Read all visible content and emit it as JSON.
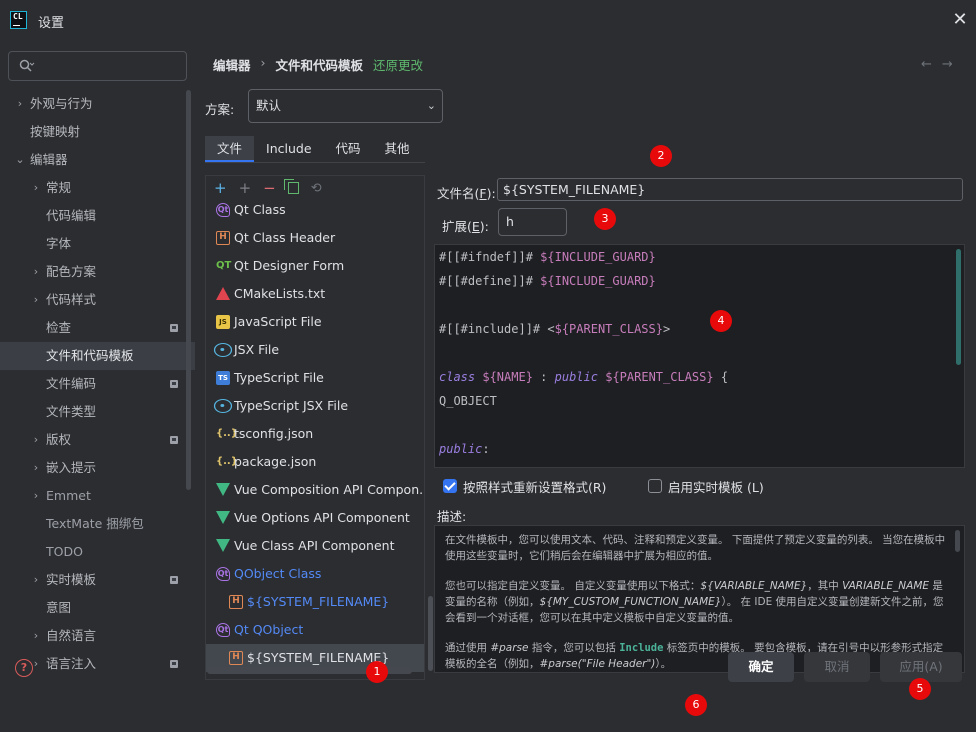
{
  "window": {
    "title": "设置",
    "logo_text": "CL"
  },
  "sidebar": {
    "search_placeholder": "",
    "items": [
      {
        "label": "外观与行为",
        "chevron": "›",
        "level": 0,
        "pinned": false
      },
      {
        "label": "按键映射",
        "chevron": "",
        "level": 0,
        "pinned": false
      },
      {
        "label": "编辑器",
        "chevron": "⌄",
        "level": 0,
        "pinned": false
      },
      {
        "label": "常规",
        "chevron": "›",
        "level": 1,
        "pinned": false
      },
      {
        "label": "代码编辑",
        "chevron": "",
        "level": 1,
        "pinned": false
      },
      {
        "label": "字体",
        "chevron": "",
        "level": 1,
        "pinned": false
      },
      {
        "label": "配色方案",
        "chevron": "›",
        "level": 1,
        "pinned": false
      },
      {
        "label": "代码样式",
        "chevron": "›",
        "level": 1,
        "pinned": false
      },
      {
        "label": "检查",
        "chevron": "",
        "level": 1,
        "pinned": true
      },
      {
        "label": "文件和代码模板",
        "chevron": "",
        "level": 1,
        "pinned": false,
        "selected": true
      },
      {
        "label": "文件编码",
        "chevron": "",
        "level": 1,
        "pinned": true
      },
      {
        "label": "文件类型",
        "chevron": "",
        "level": 1,
        "pinned": false
      },
      {
        "label": "版权",
        "chevron": "›",
        "level": 1,
        "pinned": true
      },
      {
        "label": "嵌入提示",
        "chevron": "›",
        "level": 1,
        "pinned": false
      },
      {
        "label": "Emmet",
        "chevron": "›",
        "level": 1,
        "pinned": false,
        "dim": true
      },
      {
        "label": "TextMate 捆绑包",
        "chevron": "",
        "level": 1,
        "pinned": false,
        "dim": true
      },
      {
        "label": "TODO",
        "chevron": "",
        "level": 1,
        "pinned": false,
        "dim": true
      },
      {
        "label": "实时模板",
        "chevron": "›",
        "level": 1,
        "pinned": true
      },
      {
        "label": "意图",
        "chevron": "",
        "level": 1,
        "pinned": false
      },
      {
        "label": "自然语言",
        "chevron": "›",
        "level": 1,
        "pinned": false
      },
      {
        "label": "语言注入",
        "chevron": "›",
        "level": 1,
        "pinned": true
      }
    ]
  },
  "breadcrumb": {
    "parent": "编辑器",
    "separator": "›",
    "current": "文件和代码模板",
    "revert_label": "还原更改"
  },
  "nav": {
    "back": "←",
    "forward": "→"
  },
  "scheme": {
    "label": "方案:",
    "value": "默认",
    "dropdown_icon": "⌄"
  },
  "tabs": [
    {
      "label": "文件",
      "active": true
    },
    {
      "label": "Include",
      "active": false
    },
    {
      "label": "代码",
      "active": false
    },
    {
      "label": "其他",
      "active": false
    }
  ],
  "toolbar": {
    "add": "+",
    "add_child": "+",
    "remove": "−",
    "reset": "⟲"
  },
  "templates": [
    {
      "label": "Qt Class",
      "icon": "qt-icon",
      "glyph": "Qt",
      "indent": 0,
      "link": false
    },
    {
      "label": "Qt Class Header",
      "icon": "header-icon",
      "glyph": "H",
      "indent": 0,
      "link": false
    },
    {
      "label": "Qt Designer Form",
      "icon": "qt-designer-icon",
      "glyph": "QT",
      "indent": 0,
      "link": false
    },
    {
      "label": "CMakeLists.txt",
      "icon": "cmake-icon",
      "glyph": "",
      "indent": 0,
      "link": false
    },
    {
      "label": "JavaScript File",
      "icon": "javascript-icon",
      "glyph": "JS",
      "indent": 0,
      "link": false
    },
    {
      "label": "JSX File",
      "icon": "react-icon",
      "glyph": "",
      "indent": 0,
      "link": false
    },
    {
      "label": "TypeScript File",
      "icon": "typescript-icon",
      "glyph": "TS",
      "indent": 0,
      "link": false
    },
    {
      "label": "TypeScript JSX File",
      "icon": "react-icon",
      "glyph": "",
      "indent": 0,
      "link": false
    },
    {
      "label": "tsconfig.json",
      "icon": "json-icon",
      "glyph": "{..}",
      "indent": 0,
      "link": false
    },
    {
      "label": "package.json",
      "icon": "json-icon",
      "glyph": "{..}",
      "indent": 0,
      "link": false
    },
    {
      "label": "Vue Composition API Compon...",
      "icon": "vue-icon",
      "glyph": "",
      "indent": 0,
      "link": false
    },
    {
      "label": "Vue Options API Component",
      "icon": "vue-icon",
      "glyph": "",
      "indent": 0,
      "link": false
    },
    {
      "label": "Vue Class API Component",
      "icon": "vue-icon",
      "glyph": "",
      "indent": 0,
      "link": false
    },
    {
      "label": "QObject Class",
      "icon": "qt-icon",
      "glyph": "Qt",
      "indent": 0,
      "link": true
    },
    {
      "label": "${SYSTEM_FILENAME}",
      "icon": "header-icon",
      "glyph": "H",
      "indent": 1,
      "link": true
    },
    {
      "label": "Qt QObject",
      "icon": "qt-icon",
      "glyph": "Qt",
      "indent": 0,
      "link": true
    },
    {
      "label": "${SYSTEM_FILENAME}",
      "icon": "header-icon",
      "glyph": "H",
      "indent": 1,
      "link": false,
      "selected": true
    }
  ],
  "form": {
    "filename_label": "文件名(",
    "filename_key": "F",
    "filename_label_end": "):",
    "filename_value": "${SYSTEM_FILENAME}",
    "ext_label": "扩展(",
    "ext_key": "E",
    "ext_label_end": "):",
    "ext_value": "h"
  },
  "code_lines": [
    [
      {
        "t": "#[[#ifndef]]# ",
        "c": "dir"
      },
      {
        "t": "${INCLUDE_GUARD}",
        "c": "var"
      }
    ],
    [
      {
        "t": "#[[#define]]# ",
        "c": "dir"
      },
      {
        "t": "${INCLUDE_GUARD}",
        "c": "var"
      }
    ],
    [],
    [
      {
        "t": "#[[#include]]# ",
        "c": "dir"
      },
      {
        "t": "<",
        "c": "dir"
      },
      {
        "t": "${PARENT_CLASS}",
        "c": "var"
      },
      {
        "t": ">",
        "c": "dir"
      }
    ],
    [],
    [
      {
        "t": "class",
        "c": "kw"
      },
      {
        "t": " ",
        "c": "dir"
      },
      {
        "t": "${NAME}",
        "c": "var"
      },
      {
        "t": " : ",
        "c": "dir"
      },
      {
        "t": "public",
        "c": "kw"
      },
      {
        "t": " ",
        "c": "dir"
      },
      {
        "t": "${PARENT_CLASS}",
        "c": "var"
      },
      {
        "t": " {",
        "c": "dir"
      }
    ],
    [
      {
        "t": "Q_OBJECT",
        "c": "dir"
      }
    ],
    [],
    [
      {
        "t": "public",
        "c": "kw"
      },
      {
        "t": ":",
        "c": "dir"
      }
    ]
  ],
  "options": {
    "reformat_label": "按照样式重新设置格式(R)",
    "reformat_checked": true,
    "live_template_label": "启用实时模板 (L)",
    "live_template_checked": false
  },
  "description": {
    "label": "描述:",
    "p1": "在文件模板中，您可以使用文本、代码、注释和预定义变量。 下面提供了预定义变量的列表。 当您在模板中使用这些变量时，它们稍后会在编辑器中扩展为相应的值。",
    "p2a": "您也可以指定自定义变量。 自定义变量使用以下格式：",
    "p2b": "${VARIABLE_NAME}",
    "p2c": "，其中 ",
    "p2d": "VARIABLE_NAME",
    "p2e": " 是变量的名称（例如，",
    "p2f": "${MY_CUSTOM_FUNCTION_NAME}",
    "p2g": "）。 在 IDE 使用自定义变量创建新文件之前，您会看到一个对话框，您可以在其中定义模板中自定义变量的值。",
    "p3a": "通过使用 ",
    "p3b": "#parse",
    "p3c": " 指令，您可以包括 ",
    "p3d": "Include",
    "p3e": " 标签页中的模板。 要包含模板，请在引号中以形参形式指定模板的全名（例如，",
    "p3f": "#parse(\"File Header\")",
    "p3g": "）。"
  },
  "buttons": {
    "ok": "确定",
    "cancel": "取消",
    "apply": "应用(A)"
  },
  "help_icon": "?",
  "markers": [
    "1",
    "2",
    "3",
    "4",
    "5",
    "6"
  ],
  "colors": {
    "accent": "#3574f0",
    "link": "#548af7",
    "revert": "#5fb86e",
    "marker": "#e80a0a"
  }
}
